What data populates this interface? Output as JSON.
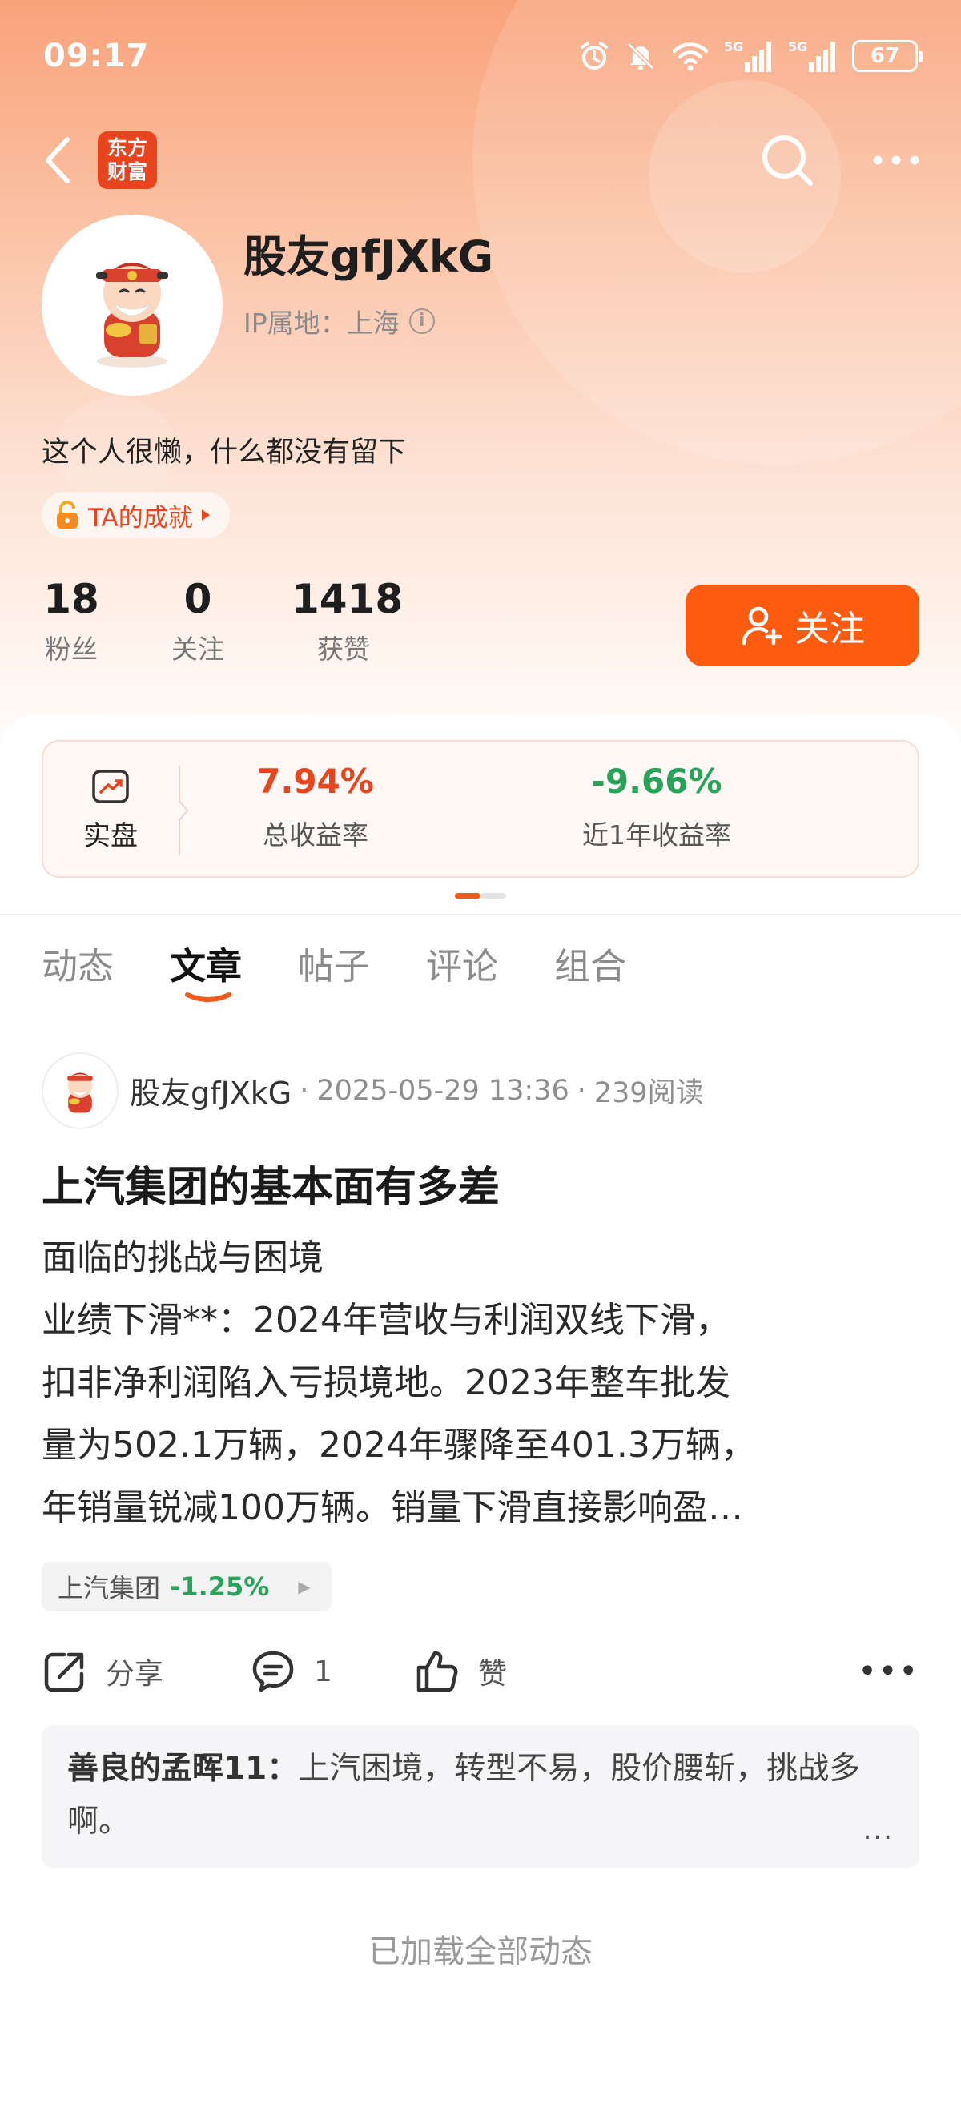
{
  "status_bar": {
    "time": "09:17",
    "battery": "67",
    "network": [
      "5G",
      "5G"
    ]
  },
  "nav": {
    "logo_text": [
      "东方",
      "财富"
    ]
  },
  "profile": {
    "name": "股友gfJXkG",
    "ip_location": "IP属地：上海",
    "bio": "这个人很懒，什么都没有留下",
    "achievement_label": "TA的成就",
    "stats": [
      {
        "num": "18",
        "label": "粉丝"
      },
      {
        "num": "0",
        "label": "关注"
      },
      {
        "num": "1418",
        "label": "获赞"
      }
    ],
    "follow_label": "关注"
  },
  "profit_card": {
    "tag_label": "实盘",
    "total_return": {
      "value": "7.94%",
      "label": "总收益率",
      "color": "#e8441d"
    },
    "year_return": {
      "value": "-9.66%",
      "label": "近1年收益率",
      "color": "#27a35a"
    }
  },
  "tabs": [
    "动态",
    "文章",
    "帖子",
    "评论",
    "组合"
  ],
  "active_tab": "文章",
  "post": {
    "author": "股友gfJXkG",
    "date": "2025-05-29 13:36",
    "reads": "239阅读",
    "title": "上汽集团的基本面有多差",
    "body_lines": [
      "面临的挑战与困境",
      "业绩下滑**：2024年营收与利润双线下滑，",
      "扣非净利润陷入亏损境地。2023年整车批发",
      "量为502.1万辆，2024年骤降至401.3万辆，",
      "年销量锐减100万辆。销量下滑直接影响盈…"
    ],
    "stock": {
      "name": "上汽集团",
      "change": "-1.25%"
    },
    "actions": {
      "share": "分享",
      "comments": "1",
      "like": "赞"
    },
    "top_comment": {
      "author": "善良的孟晖11：",
      "text": "上汽困境，转型不易，股价腰斩，挑战多啊。"
    }
  },
  "footer_text": "已加载全部动态"
}
